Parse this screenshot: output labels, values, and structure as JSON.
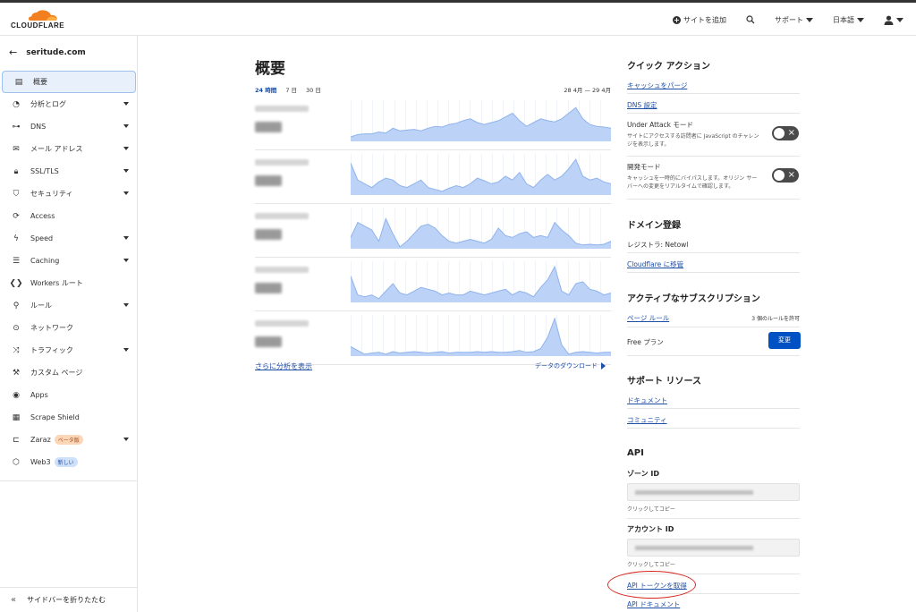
{
  "header": {
    "logo_text": "CLOUDFLARE",
    "add_site": "サイトを追加",
    "support": "サポート",
    "language": "日本語"
  },
  "sidebar": {
    "zone": "seritude.com",
    "items": [
      {
        "label": "概要",
        "icon": "document-icon",
        "active": true,
        "expandable": false
      },
      {
        "label": "分析とログ",
        "icon": "clock-chart-icon",
        "expandable": true
      },
      {
        "label": "DNS",
        "icon": "network-tree-icon",
        "expandable": true
      },
      {
        "label": "メール アドレス",
        "icon": "mail-icon",
        "expandable": true
      },
      {
        "label": "SSL/TLS",
        "icon": "lock-icon",
        "expandable": true
      },
      {
        "label": "セキュリティ",
        "icon": "shield-icon",
        "expandable": true
      },
      {
        "label": "Access",
        "icon": "access-icon",
        "expandable": false
      },
      {
        "label": "Speed",
        "icon": "bolt-icon",
        "expandable": true
      },
      {
        "label": "Caching",
        "icon": "server-icon",
        "expandable": true
      },
      {
        "label": "Workers ルート",
        "icon": "workers-icon",
        "expandable": false
      },
      {
        "label": "ルール",
        "icon": "rules-icon",
        "expandable": true
      },
      {
        "label": "ネットワーク",
        "icon": "location-icon",
        "expandable": false
      },
      {
        "label": "トラフィック",
        "icon": "traffic-icon",
        "expandable": true
      },
      {
        "label": "カスタム ページ",
        "icon": "wrench-icon",
        "expandable": false
      },
      {
        "label": "Apps",
        "icon": "apps-icon",
        "expandable": false
      },
      {
        "label": "Scrape Shield",
        "icon": "scrape-shield-icon",
        "expandable": false
      },
      {
        "label": "Zaraz",
        "icon": "zaraz-icon",
        "expandable": true,
        "badge": "ベータ版",
        "badge_type": "beta"
      },
      {
        "label": "Web3",
        "icon": "web3-icon",
        "expandable": false,
        "badge": "新しい",
        "badge_type": "new"
      }
    ],
    "collapse_label": "サイドバーを折りたたむ"
  },
  "overview": {
    "title": "概要",
    "range_tabs": [
      "24 時間",
      "7 日",
      "30 日"
    ],
    "selected_range": "24 時間",
    "date_range": "28 4月 — 29 4月",
    "metrics": [
      {
        "spark": [
          0.12,
          0.18,
          0.2,
          0.2,
          0.25,
          0.22,
          0.35,
          0.28,
          0.3,
          0.32,
          0.28,
          0.35,
          0.4,
          0.38,
          0.45,
          0.48,
          0.55,
          0.6,
          0.5,
          0.45,
          0.5,
          0.55,
          0.65,
          0.75,
          0.55,
          0.4,
          0.5,
          0.6,
          0.55,
          0.52,
          0.6,
          0.75,
          0.9,
          0.6,
          0.45,
          0.4,
          0.38,
          0.35
        ]
      },
      {
        "spark": [
          0.85,
          0.4,
          0.3,
          0.2,
          0.35,
          0.45,
          0.4,
          0.25,
          0.2,
          0.3,
          0.4,
          0.2,
          0.15,
          0.1,
          0.18,
          0.25,
          0.2,
          0.3,
          0.45,
          0.38,
          0.3,
          0.35,
          0.5,
          0.4,
          0.6,
          0.3,
          0.2,
          0.4,
          0.55,
          0.4,
          0.5,
          0.7,
          0.95,
          0.5,
          0.4,
          0.45,
          0.35,
          0.3
        ]
      },
      {
        "spark": [
          0.3,
          0.7,
          0.6,
          0.5,
          0.2,
          0.8,
          0.4,
          0.05,
          0.2,
          0.4,
          0.6,
          0.65,
          0.55,
          0.35,
          0.2,
          0.15,
          0.2,
          0.25,
          0.2,
          0.15,
          0.25,
          0.55,
          0.35,
          0.3,
          0.4,
          0.45,
          0.3,
          0.35,
          0.3,
          0.7,
          0.5,
          0.35,
          0.15,
          0.1,
          0.12,
          0.1,
          0.12,
          0.2
        ]
      },
      {
        "spark": [
          0.7,
          0.2,
          0.15,
          0.2,
          0.1,
          0.3,
          0.5,
          0.25,
          0.2,
          0.3,
          0.4,
          0.35,
          0.3,
          0.2,
          0.25,
          0.2,
          0.2,
          0.3,
          0.25,
          0.2,
          0.25,
          0.3,
          0.35,
          0.2,
          0.3,
          0.25,
          0.15,
          0.4,
          0.6,
          0.95,
          0.3,
          0.2,
          0.5,
          0.55,
          0.35,
          0.3,
          0.2,
          0.25
        ]
      },
      {
        "spark": [
          0.25,
          0.15,
          0.05,
          0.08,
          0.1,
          0.05,
          0.12,
          0.08,
          0.1,
          0.12,
          0.1,
          0.08,
          0.1,
          0.12,
          0.08,
          0.1,
          0.1,
          0.1,
          0.12,
          0.1,
          0.12,
          0.1,
          0.1,
          0.12,
          0.15,
          0.1,
          0.12,
          0.2,
          0.5,
          1.0,
          0.3,
          0.05,
          0.1,
          0.12,
          0.1,
          0.08,
          0.1,
          0.1
        ]
      }
    ],
    "more_analytics": "さらに分析を表示",
    "download_data": "データのダウンロード"
  },
  "quick_actions": {
    "title": "クイック アクション",
    "purge_cache": "キャッシュをパージ",
    "dns_settings": "DNS 設定",
    "under_attack_title": "Under Attack モード",
    "under_attack_desc": "サイトにアクセスする訪問者に JavaScript のチャレンジを表示します。",
    "dev_mode_title": "開発モード",
    "dev_mode_desc": "キャッシュを一時的にバイパスします。オリジン サーバーへの変更をリアルタイムで確認します。"
  },
  "domain_registration": {
    "title": "ドメイン登録",
    "registrar": "レジストラ: Netowl",
    "transfer": "Cloudflare に移管"
  },
  "subscriptions": {
    "title": "アクティブなサブスクリプション",
    "page_rules": "ページ ルール",
    "page_rules_count": "3 個のルールを許可",
    "plan": "Free プラン",
    "change_button": "変更"
  },
  "support_resources": {
    "title": "サポート リソース",
    "docs": "ドキュメント",
    "community": "コミュニティ"
  },
  "api": {
    "title": "API",
    "zone_id_label": "ゾーン ID",
    "zone_copy": "クリックしてコピー",
    "account_id_label": "アカウント ID",
    "account_copy": "クリックしてコピー",
    "get_token": "API トークンを取得",
    "api_docs": "API ドキュメント"
  },
  "colors": {
    "accent": "#1d4fa8",
    "button": "#0051c3",
    "spark_fill": "#bcd3f7",
    "spark_line": "#8fb3ec",
    "highlight_oval": "#d9251d"
  }
}
